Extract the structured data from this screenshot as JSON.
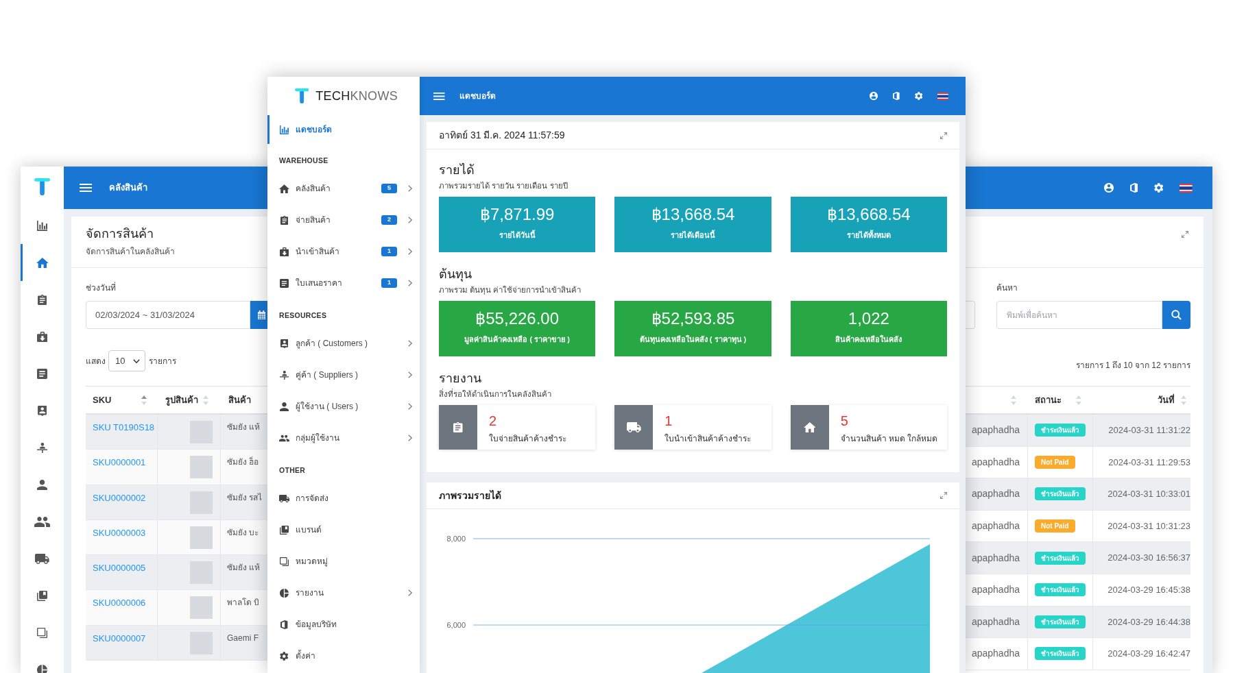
{
  "back_window": {
    "nav": [
      {
        "selected": false
      },
      {
        "selected": true
      },
      {
        "selected": false
      },
      {
        "selected": false
      },
      {
        "selected": false
      },
      {
        "selected": false
      },
      {
        "selected": false
      },
      {
        "selected": false
      },
      {
        "selected": false
      },
      {
        "selected": false
      },
      {
        "selected": false
      },
      {
        "selected": false
      },
      {
        "selected": false
      }
    ],
    "header": {
      "title": "คลังสินค้า"
    },
    "card": {
      "title": "จัดการสินค้า",
      "subtitle": "จัดการสินค้าในคลังสินค้า"
    },
    "date_range": {
      "label": "ช่วงวันที่",
      "value": "02/03/2024 ~ 31/03/2024"
    },
    "page_length": {
      "prefix": "แสดง",
      "value": "10",
      "suffix": "รายการ"
    },
    "search": {
      "label": "ค้นหา",
      "placeholder": "พิมพ์เพื่อค้นหา"
    },
    "table_info": "รายการ 1 ถึง 10 จาก 12 รายการ",
    "products_table": {
      "columns": [
        {
          "label": "SKU",
          "sorted": true
        },
        {
          "label": "รูปสินค้า",
          "sorted": false
        },
        {
          "label": "สินค้า"
        }
      ],
      "rows": [
        {
          "sku": "SKU T0190S18",
          "product": "ซัมยัง แห้"
        },
        {
          "sku": "SKU0000001",
          "product": "ซัมยัง ฮ็อ"
        },
        {
          "sku": "SKU0000002",
          "product": "ซัมยัง รสไ"
        },
        {
          "sku": "SKU0000003",
          "product": "ซัมยัง บะ"
        },
        {
          "sku": "SKU0000005",
          "product": "ซัมยัง แห้"
        },
        {
          "sku": "SKU0000006",
          "product": "พาลโด บิ"
        },
        {
          "sku": "SKU0000007",
          "product": "Gaemi F"
        }
      ]
    },
    "orders_table": {
      "columns": [
        {
          "sorted": false
        },
        {
          "label": "สถานะ",
          "sorted": false
        },
        {
          "label": "วันที่",
          "sorted": false
        }
      ],
      "rows": [
        {
          "column_1": "apaphadha",
          "status": {
            "label": "ชำระเงินแล้ว",
            "color": "#27d5c8"
          },
          "date": "2024-03-31 11:31:22"
        },
        {
          "column_1": "apaphadha",
          "status": {
            "label": "Not Paid",
            "color": "#fbab2c"
          },
          "date": "2024-03-31 11:29:53"
        },
        {
          "column_1": "apaphadha",
          "status": {
            "label": "ชำระเงินแล้ว",
            "color": "#27d5c8"
          },
          "date": "2024-03-31 10:33:01"
        },
        {
          "column_1": "apaphadha",
          "status": {
            "label": "Not Paid",
            "color": "#fbab2c"
          },
          "date": "2024-03-31 10:31:23"
        },
        {
          "column_1": "apaphadha",
          "status": {
            "label": "ชำระเงินแล้ว",
            "color": "#27d5c8"
          },
          "date": "2024-03-30 16:56:37"
        },
        {
          "column_1": "apaphadha",
          "status": {
            "label": "ชำระเงินแล้ว",
            "color": "#27d5c8"
          },
          "date": "2024-03-29 16:45:38"
        },
        {
          "column_1": "apaphadha",
          "status": {
            "label": "ชำระเงินแล้ว",
            "color": "#27d5c8"
          },
          "date": "2024-03-29 16:44:38"
        },
        {
          "column_1": "apaphadha",
          "status": {
            "label": "ชำระเงินแล้ว",
            "color": "#27d5c8"
          },
          "date": "2024-03-29 16:42:47"
        }
      ]
    }
  },
  "front_window": {
    "sidebar": {
      "brand": "**TECH**KNOWS",
      "sections": [
        {
          "items": [
            {
              "label": "แดชบอร์ด",
              "selected": true,
              "has_submenu": false
            }
          ]
        },
        {
          "heading": "WAREHOUSE",
          "items": [
            {
              "label": "คลังสินค้า",
              "badge": "5",
              "selected": false,
              "has_submenu": true
            },
            {
              "label": "จ่ายสินค้า",
              "badge": "2",
              "selected": false,
              "has_submenu": true
            },
            {
              "label": "นำเข้าสินค้า",
              "badge": "1",
              "selected": false,
              "has_submenu": true
            },
            {
              "label": "ใบเสนอราคา",
              "badge": "1",
              "selected": false,
              "has_submenu": true
            }
          ]
        },
        {
          "heading": "RESOURCES",
          "items": [
            {
              "label": "ลูกค้า ( Customers )",
              "selected": false,
              "has_submenu": true
            },
            {
              "label": "คู่ค้า ( Suppliers )",
              "selected": false,
              "has_submenu": true
            },
            {
              "label": "ผู้ใช้งาน ( Users )",
              "selected": false,
              "has_submenu": true
            },
            {
              "label": "กลุ่มผู้ใช้งาน",
              "selected": false,
              "has_submenu": true
            }
          ]
        },
        {
          "heading": "OTHER",
          "items": [
            {
              "label": "การจัดส่ง",
              "selected": false,
              "has_submenu": false
            },
            {
              "label": "แบรนด์",
              "selected": false,
              "has_submenu": false
            },
            {
              "label": "หมวดหมู่",
              "selected": false,
              "has_submenu": false
            },
            {
              "label": "รายงาน",
              "selected": false,
              "has_submenu": true
            },
            {
              "label": "ข้อมูลบริษัท",
              "selected": false,
              "has_submenu": false
            },
            {
              "label": "ตั้งค่า",
              "selected": false,
              "has_submenu": false
            }
          ]
        }
      ]
    },
    "header": {
      "title": "แดชบอร์ด"
    },
    "summary_card": {
      "datetime": "อาทิตย์ 31 มี.ค. 2024 11:57:59",
      "groups": [
        {
          "kind": "stat",
          "title": "รายได้",
          "subtitle": "ภาพรวมรายได้ รายวัน รายเดือน รายปี",
          "color": "#17a2b8",
          "tiles": [
            {
              "value": "฿7,871.99",
              "label": "รายได้วันนี้"
            },
            {
              "value": "฿13,668.54",
              "label": "รายได้เดือนนี้"
            },
            {
              "value": "฿13,668.54",
              "label": "รายได้ทั้งหมด"
            }
          ]
        },
        {
          "kind": "stat",
          "title": "ต้นทุน",
          "subtitle": "ภาพรวม ต้นทุน ค่าใช้จ่ายการนำเข้าสินค้า",
          "color": "#28a745",
          "tiles": [
            {
              "value": "฿55,226.00",
              "label": "มูลค่าสินค้าคงเหลือ ( ราคาขาย )"
            },
            {
              "value": "฿52,593.85",
              "label": "ต้นทุนคงเหลือในคลัง ( ราคาทุน )"
            },
            {
              "value": "1,022",
              "label": "สินค้าคงเหลือในคลัง"
            }
          ]
        },
        {
          "kind": "report",
          "title": "รายงาน",
          "subtitle": "สิ่งที่รอให้ดำเนินการในคลังสินค้า",
          "tiles": [
            {
              "count": "2",
              "label": "ใบจ่ายสินค้าค้างชำระ"
            },
            {
              "count": "1",
              "label": "ใบนำเข้าสินค้าค้างชำระ"
            },
            {
              "count": "5",
              "label": "จำนวนสินค้า หมด ใกล้หมด"
            }
          ]
        }
      ]
    },
    "chart_card": {
      "title": "ภาพรวมรายได้",
      "y_axis_labels": [
        "8,000",
        "6,000"
      ]
    }
  }
}
